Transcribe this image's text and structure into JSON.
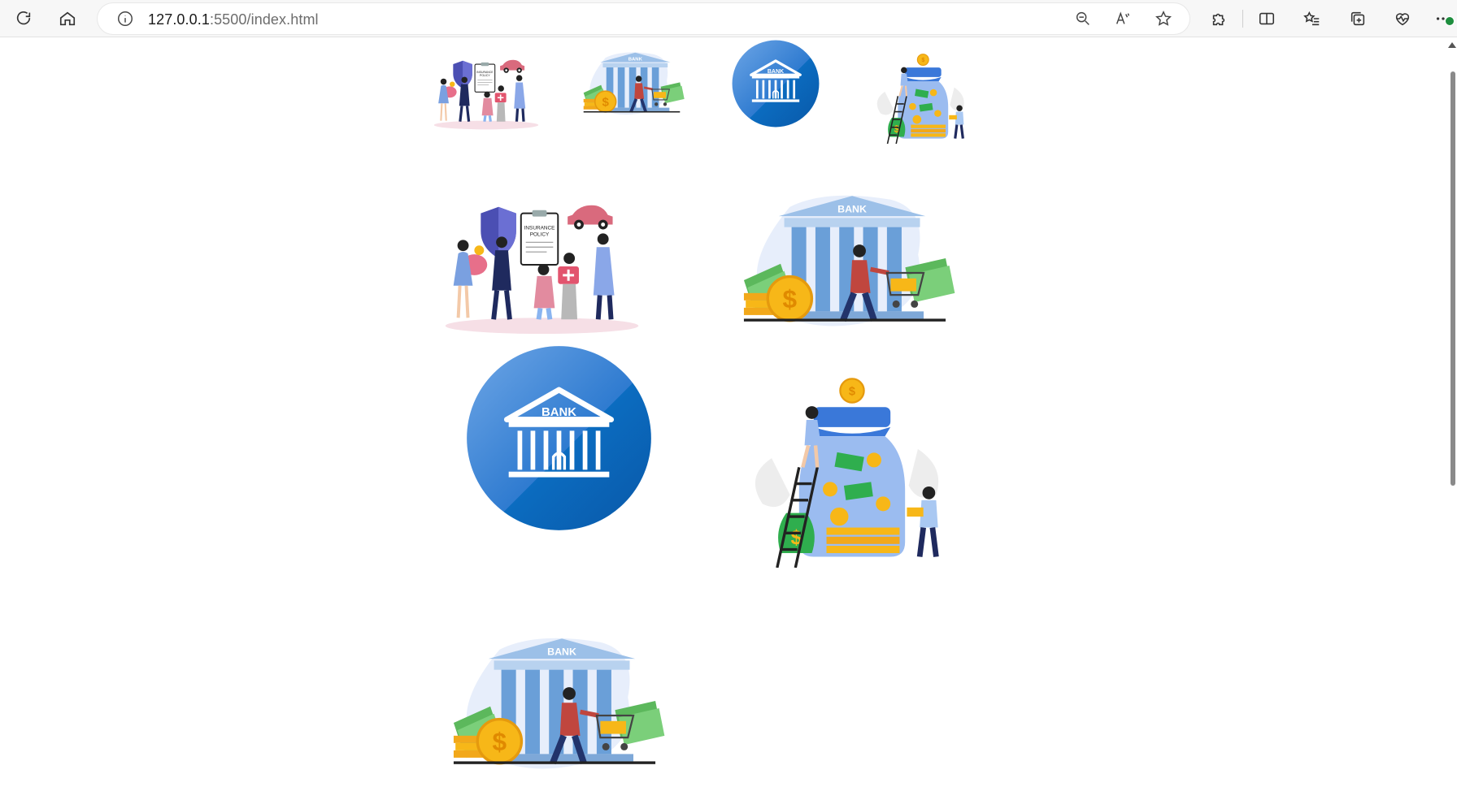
{
  "browser": {
    "address": {
      "host": "127.0.0.1",
      "path": ":5500/index.html"
    },
    "icons": {
      "reload": "reload-icon",
      "home": "home-icon",
      "info": "site-info-icon",
      "zoom": "zoom-out-icon",
      "read_aloud": "read-aloud-icon",
      "favorite": "star-icon",
      "extensions": "puzzle-icon",
      "split": "split-screen-icon",
      "favorites": "favorites-list-icon",
      "collections": "collections-icon",
      "health": "browser-essentials-icon",
      "more": "more-dots-icon"
    }
  },
  "gallery": {
    "images": [
      {
        "name": "insurance-family",
        "bank_label": ""
      },
      {
        "name": "bank-building",
        "bank_label": "BANK"
      },
      {
        "name": "bank-badge",
        "bank_label": "BANK"
      },
      {
        "name": "savings-jar",
        "bank_label": ""
      }
    ],
    "insurance_sign": "INSURANCE POLICY",
    "bank_word": "BANK",
    "dollar": "$"
  },
  "colors": {
    "bank_blue_light": "#4a90d9",
    "bank_blue_dark": "#0b63b6",
    "coin_gold": "#f7b718",
    "cash_green": "#5cb85c",
    "shield_purple": "#4b4fb3",
    "pink": "#e76f8a"
  }
}
